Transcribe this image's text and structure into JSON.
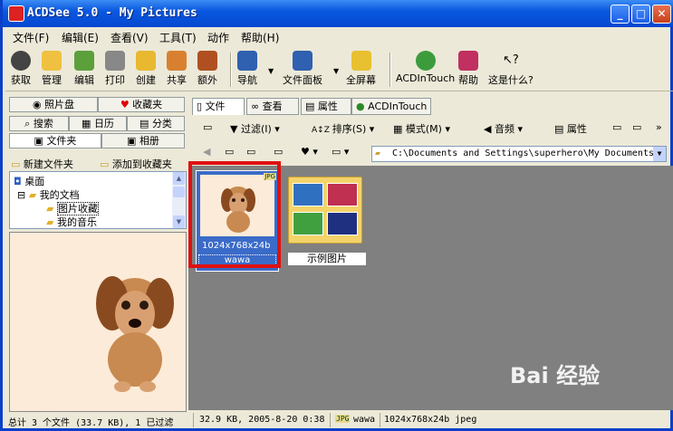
{
  "window": {
    "title": "ACDSee 5.0 - My Pictures"
  },
  "menu": [
    "文件(F)",
    "编辑(E)",
    "查看(V)",
    "工具(T)",
    "动作",
    "帮助(H)"
  ],
  "toolbar": {
    "acquire": "获取",
    "manage": "管理",
    "edit": "编辑",
    "print": "打印",
    "create": "创建",
    "share": "共享",
    "extra": "额外",
    "nav": "导航",
    "filepanel": "文件面板",
    "fullscreen": "全屏幕",
    "acdintouch": "ACDInTouch",
    "help": "帮助",
    "whatsthis": "这是什么?"
  },
  "left_tabs": {
    "photo_disc": "照片盘",
    "favorites": "收藏夹",
    "search": "搜索",
    "calendar": "日历",
    "category": "分类",
    "folder": "文件夹",
    "album": "相册"
  },
  "left_toolbar": {
    "new_folder": "新建文件夹",
    "add_favorites": "添加到收藏夹"
  },
  "tree": [
    "桌面",
    "我的文档",
    "图片收藏",
    "我的音乐"
  ],
  "main_tabs": [
    "文件",
    "查看",
    "属性",
    "ACDInTouch"
  ],
  "main_toolbar": {
    "filter": "过滤(I)",
    "sort": "排序(S)",
    "mode": "模式(M)",
    "audio": "音频",
    "properties": "属性"
  },
  "path": "C:\\Documents and Settings\\superhero\\My Documents",
  "files": {
    "thumb_size": "1024x768x24b",
    "thumb_name": "wawa",
    "thumb_badge": "JPG",
    "folder_name": "示例图片"
  },
  "status": {
    "total": "总计 3 个文件 (33.7 KB), 1 已过滤",
    "info": "32.9 KB, 2005-8-20 0:38",
    "name": "wawa",
    "dims": "1024x768x24b jpeg"
  },
  "watermark": "Bai 经验"
}
